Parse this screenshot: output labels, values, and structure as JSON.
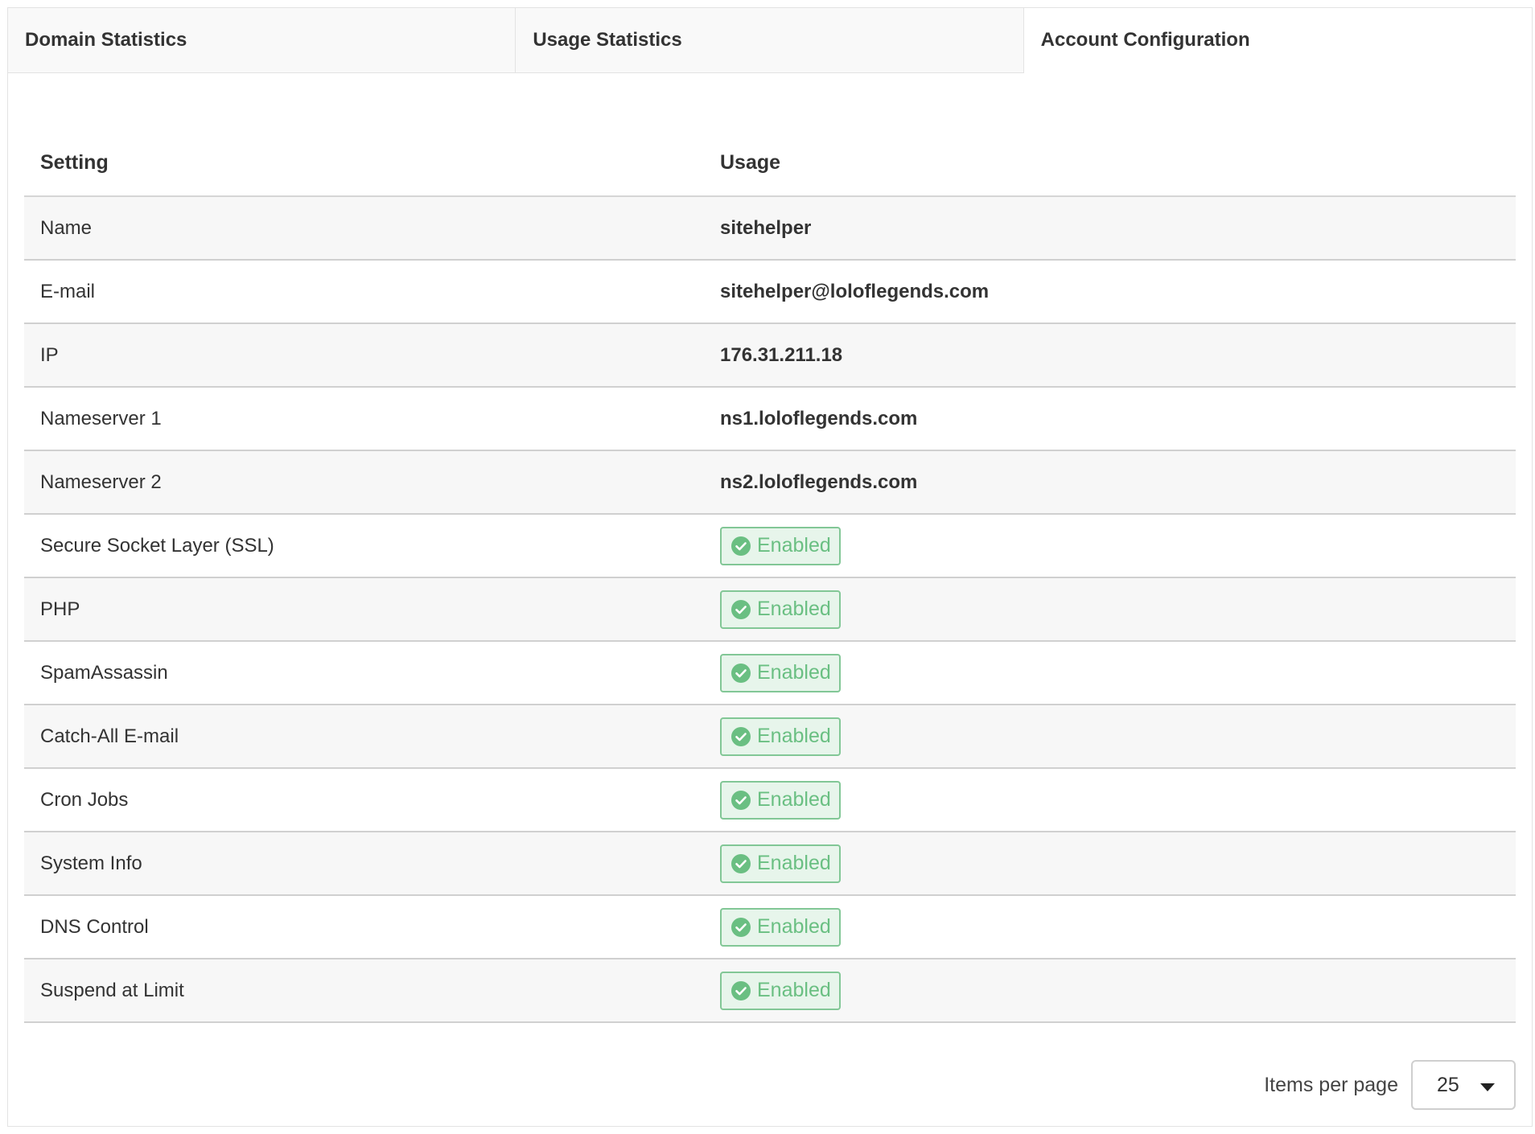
{
  "tabs": [
    {
      "label": "Domain Statistics",
      "active": false
    },
    {
      "label": "Usage Statistics",
      "active": false
    },
    {
      "label": "Account Configuration",
      "active": true
    }
  ],
  "table": {
    "headers": {
      "setting": "Setting",
      "usage": "Usage"
    },
    "rows": [
      {
        "setting": "Name",
        "value": "sitehelper",
        "type": "text"
      },
      {
        "setting": "E-mail",
        "value": "sitehelper@loloflegends.com",
        "type": "text"
      },
      {
        "setting": "IP",
        "value": "176.31.211.18",
        "type": "text"
      },
      {
        "setting": "Nameserver 1",
        "value": "ns1.loloflegends.com",
        "type": "text"
      },
      {
        "setting": "Nameserver 2",
        "value": "ns2.loloflegends.com",
        "type": "text"
      },
      {
        "setting": "Secure Socket Layer (SSL)",
        "value": "Enabled",
        "type": "badge"
      },
      {
        "setting": "PHP",
        "value": "Enabled",
        "type": "badge"
      },
      {
        "setting": "SpamAssassin",
        "value": "Enabled",
        "type": "badge"
      },
      {
        "setting": "Catch-All E-mail",
        "value": "Enabled",
        "type": "badge"
      },
      {
        "setting": "Cron Jobs",
        "value": "Enabled",
        "type": "badge"
      },
      {
        "setting": "System Info",
        "value": "Enabled",
        "type": "badge"
      },
      {
        "setting": "DNS Control",
        "value": "Enabled",
        "type": "badge"
      },
      {
        "setting": "Suspend at Limit",
        "value": "Enabled",
        "type": "badge"
      }
    ]
  },
  "pagination": {
    "items_per_page_label": "Items per page",
    "items_per_page_value": "25"
  },
  "colors": {
    "badge_text": "#6abf82",
    "badge_border": "#82c796",
    "badge_bg": "#e7f5eb",
    "check_circle": "#6abf82"
  },
  "icons": {
    "badge_icon": "check-circle-icon",
    "select_icon": "caret-down-icon"
  }
}
